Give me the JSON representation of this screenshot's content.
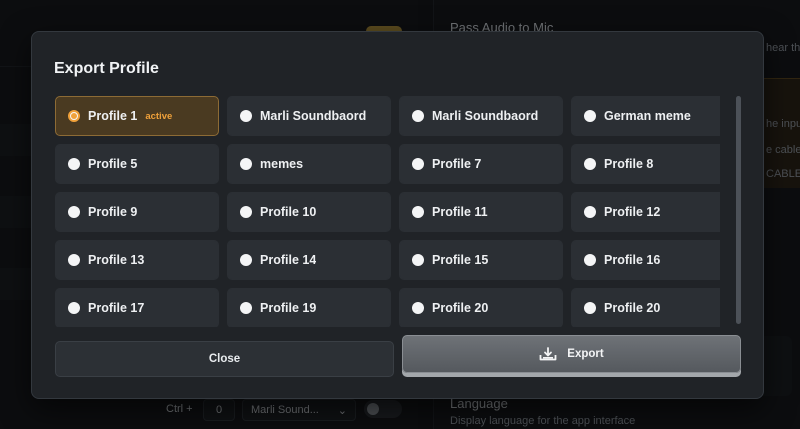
{
  "background": {
    "right_title": "Pass Audio to Mic",
    "right_sub": "hear th",
    "warn_lines": [
      "he inpu",
      "e cable",
      "CABLE)."
    ],
    "language_title": "Language",
    "language_sub": "Display language for the app interface",
    "hotkey_prefix": "Ctrl +",
    "hotkey_value": "0",
    "hotkey_select": "Marli Sound...",
    "hotkey_chevron": "⌄"
  },
  "modal": {
    "title": "Export Profile",
    "profiles": [
      {
        "label": "Profile 1",
        "badge": "active",
        "selected": true
      },
      {
        "label": "Marli Soundbaord"
      },
      {
        "label": "Marli Soundbaord"
      },
      {
        "label": "German meme"
      },
      {
        "label": "Profile 5"
      },
      {
        "label": "memes"
      },
      {
        "label": "Profile 7"
      },
      {
        "label": "Profile 8"
      },
      {
        "label": "Profile 9"
      },
      {
        "label": "Profile 10"
      },
      {
        "label": "Profile 11"
      },
      {
        "label": "Profile 12"
      },
      {
        "label": "Profile 13"
      },
      {
        "label": "Profile 14"
      },
      {
        "label": "Profile 15"
      },
      {
        "label": "Profile 16"
      },
      {
        "label": "Profile 17"
      },
      {
        "label": "Profile 19"
      },
      {
        "label": "Profile 20"
      },
      {
        "label": "Profile 20"
      }
    ],
    "close_label": "Close",
    "export_label": "Export",
    "export_icon": "download-tray-icon"
  },
  "colors": {
    "accent": "#f0a13a",
    "selected_bg": "#4a3a21",
    "card_bg": "#2b2f34",
    "modal_bg": "#202327"
  }
}
